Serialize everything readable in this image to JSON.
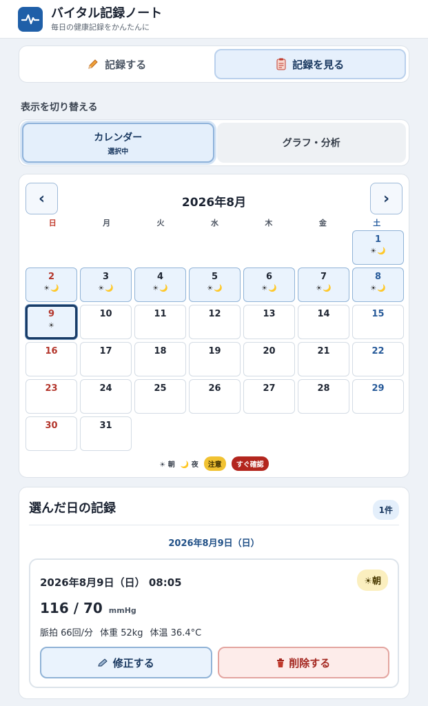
{
  "app": {
    "title": "バイタル記録ノート",
    "subtitle": "毎日の健康記録をかんたんに",
    "icon": "heartbeat-icon"
  },
  "mode_tabs": [
    {
      "label": "記録する",
      "icon": "pencil-icon",
      "active": false
    },
    {
      "label": "記録を見る",
      "icon": "clipboard-icon",
      "active": true
    }
  ],
  "view_switch": {
    "label": "表示を切り替える",
    "options": [
      {
        "label": "カレンダー",
        "sub": "選択中",
        "active": true
      },
      {
        "label": "グラフ・分析",
        "sub": "",
        "active": false
      }
    ]
  },
  "calendar": {
    "month_label": "2026年8月",
    "prev": "‹",
    "next": "›",
    "weekdays": [
      "日",
      "月",
      "火",
      "水",
      "木",
      "金",
      "土"
    ],
    "first_weekday_index": 6,
    "days_in_month": 31,
    "selected_day": 9,
    "records": {
      "1": "☀🌙",
      "2": "☀🌙",
      "3": "☀🌙",
      "4": "☀🌙",
      "5": "☀🌙",
      "6": "☀🌙",
      "7": "☀🌙",
      "8": "☀🌙",
      "9": "☀"
    },
    "legend": {
      "morning": "朝",
      "night": "夜",
      "warning": "注意",
      "urgent": "すぐ確認"
    },
    "colors": {
      "sunday": "#b3352b",
      "saturday": "#275a99",
      "selected": "#183b66",
      "warning": "#f1c232",
      "urgent": "#b3261e"
    }
  },
  "records_panel": {
    "title": "選んだ日の記録",
    "count": "1件",
    "date_label": "2026年8月9日（日）",
    "entries": [
      {
        "datetime": "2026年8月9日（日） 08:05",
        "period": "朝",
        "bp": "116 / 70",
        "bp_unit": "mmHg",
        "pulse": "脈拍 66回/分",
        "weight": "体重 52kg",
        "temp": "体温 36.4°C",
        "edit_label": "修正する",
        "delete_label": "削除する"
      }
    ]
  }
}
